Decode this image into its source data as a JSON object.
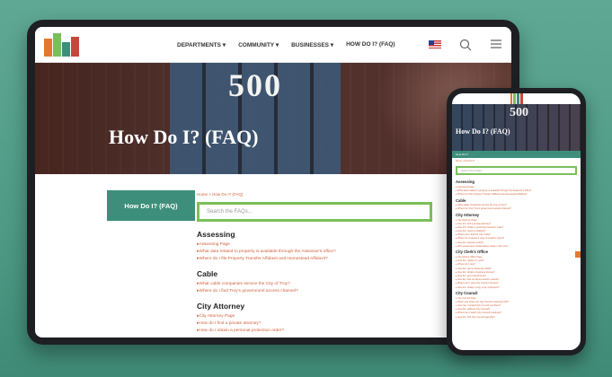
{
  "site": {
    "nav": [
      "DEPARTMENTS ▾",
      "COMMUNITY ▾",
      "BUSINESSES ▾",
      "HOW DO I? (FAQ)"
    ]
  },
  "hero": {
    "number": "500",
    "title": "How Do I? (FAQ)"
  },
  "sidebar": {
    "label": "How Do I? (FAQ)"
  },
  "breadcrumb": "Home  >  How Do I? (FAQ)",
  "search": {
    "placeholder": "Search the FAQs..."
  },
  "sections": [
    {
      "title": "Assessing",
      "links": [
        "Assessing Page",
        "What data related to property is available through the Assessor's office?",
        "Where do I file Property Transfer Affidavit and Homestead Affidavit?"
      ]
    },
    {
      "title": "Cable",
      "links": [
        "What cable companies service the City of Troy?",
        "Where do I find Troy's government access channel?"
      ]
    },
    {
      "title": "City Attorney",
      "links": [
        "City Attorney Page",
        "How do I find a private attorney?",
        "How do I obtain a personal protection order?"
      ]
    }
  ],
  "phone": {
    "number": "500",
    "title": "How Do I? (FAQ)",
    "band": "How Do I?",
    "crumb": "Home  >  How Do I?",
    "search_placeholder": "Search the FAQs...",
    "sections": [
      {
        "title": "Assessing",
        "links": [
          "Assessing Page",
          "What data related to property is available through the Assessor's office?",
          "Where do I file Property Transfer Affidavit and Homestead Affidavit?"
        ]
      },
      {
        "title": "Cable",
        "links": [
          "What cable companies service the City of Troy?",
          "Where do I find Troy's government access channel?"
        ]
      },
      {
        "title": "City Attorney",
        "links": [
          "City Attorney Page",
          "How do I find a private attorney?",
          "How do I obtain a personal protection order?",
          "How do I report a violation?",
          "Where can I find the City Code?",
          "Where do I request a copy of a police report?",
          "How do I appeal a ticket?",
          "Who prosecutes misdemeanor cases in the City?"
        ]
      },
      {
        "title": "City Clerk's Office",
        "links": [
          "City Clerk's Office Page",
          "How do I register to vote?",
          "Where do I vote?",
          "How do I get an absentee ballot?",
          "How do I obtain a business license?",
          "How do I get a dog license?",
          "How do I find out about election results?",
          "Where can I view City Council minutes?",
          "How do I obtain a copy of an ordinance?"
        ]
      },
      {
        "title": "City Council",
        "links": [
          "City Council Page",
          "When and where are City Council meetings held?",
          "How can I contact City Council members?",
          "How do I address City Council?",
          "Where can I watch City Council meetings?",
          "How do I find City Council agendas?"
        ]
      }
    ]
  },
  "colors": {
    "accent": "#3d8f7b",
    "link": "#d0603a",
    "search_border": "#7bbf5a"
  },
  "icons": [
    "us-flag-icon",
    "search-icon",
    "menu-icon"
  ]
}
